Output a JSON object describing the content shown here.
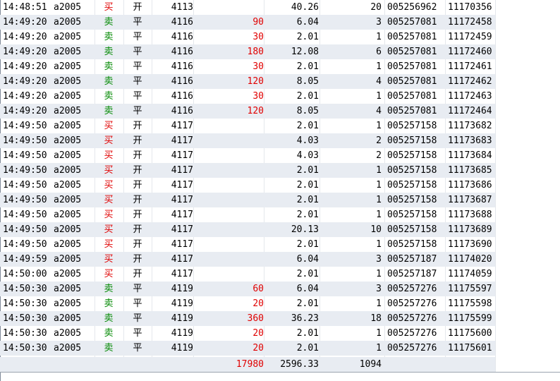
{
  "trades": [
    {
      "time": "14:48:51",
      "code": "a2005",
      "dir": "买",
      "oc": "开",
      "px": "4113",
      "diff": "",
      "price": "40.26",
      "qty": "20",
      "acct": "005256962",
      "order": "11170356"
    },
    {
      "time": "14:49:20",
      "code": "a2005",
      "dir": "卖",
      "oc": "平",
      "px": "4116",
      "diff": "90",
      "price": "6.04",
      "qty": "3",
      "acct": "005257081",
      "order": "11172458"
    },
    {
      "time": "14:49:20",
      "code": "a2005",
      "dir": "卖",
      "oc": "平",
      "px": "4116",
      "diff": "30",
      "price": "2.01",
      "qty": "1",
      "acct": "005257081",
      "order": "11172459"
    },
    {
      "time": "14:49:20",
      "code": "a2005",
      "dir": "卖",
      "oc": "平",
      "px": "4116",
      "diff": "180",
      "price": "12.08",
      "qty": "6",
      "acct": "005257081",
      "order": "11172460"
    },
    {
      "time": "14:49:20",
      "code": "a2005",
      "dir": "卖",
      "oc": "平",
      "px": "4116",
      "diff": "30",
      "price": "2.01",
      "qty": "1",
      "acct": "005257081",
      "order": "11172461"
    },
    {
      "time": "14:49:20",
      "code": "a2005",
      "dir": "卖",
      "oc": "平",
      "px": "4116",
      "diff": "120",
      "price": "8.05",
      "qty": "4",
      "acct": "005257081",
      "order": "11172462"
    },
    {
      "time": "14:49:20",
      "code": "a2005",
      "dir": "卖",
      "oc": "平",
      "px": "4116",
      "diff": "30",
      "price": "2.01",
      "qty": "1",
      "acct": "005257081",
      "order": "11172463"
    },
    {
      "time": "14:49:20",
      "code": "a2005",
      "dir": "卖",
      "oc": "平",
      "px": "4116",
      "diff": "120",
      "price": "8.05",
      "qty": "4",
      "acct": "005257081",
      "order": "11172464"
    },
    {
      "time": "14:49:50",
      "code": "a2005",
      "dir": "买",
      "oc": "开",
      "px": "4117",
      "diff": "",
      "price": "2.01",
      "qty": "1",
      "acct": "005257158",
      "order": "11173682"
    },
    {
      "time": "14:49:50",
      "code": "a2005",
      "dir": "买",
      "oc": "开",
      "px": "4117",
      "diff": "",
      "price": "4.03",
      "qty": "2",
      "acct": "005257158",
      "order": "11173683"
    },
    {
      "time": "14:49:50",
      "code": "a2005",
      "dir": "买",
      "oc": "开",
      "px": "4117",
      "diff": "",
      "price": "4.03",
      "qty": "2",
      "acct": "005257158",
      "order": "11173684"
    },
    {
      "time": "14:49:50",
      "code": "a2005",
      "dir": "买",
      "oc": "开",
      "px": "4117",
      "diff": "",
      "price": "2.01",
      "qty": "1",
      "acct": "005257158",
      "order": "11173685"
    },
    {
      "time": "14:49:50",
      "code": "a2005",
      "dir": "买",
      "oc": "开",
      "px": "4117",
      "diff": "",
      "price": "2.01",
      "qty": "1",
      "acct": "005257158",
      "order": "11173686"
    },
    {
      "time": "14:49:50",
      "code": "a2005",
      "dir": "买",
      "oc": "开",
      "px": "4117",
      "diff": "",
      "price": "2.01",
      "qty": "1",
      "acct": "005257158",
      "order": "11173687"
    },
    {
      "time": "14:49:50",
      "code": "a2005",
      "dir": "买",
      "oc": "开",
      "px": "4117",
      "diff": "",
      "price": "2.01",
      "qty": "1",
      "acct": "005257158",
      "order": "11173688"
    },
    {
      "time": "14:49:50",
      "code": "a2005",
      "dir": "买",
      "oc": "开",
      "px": "4117",
      "diff": "",
      "price": "20.13",
      "qty": "10",
      "acct": "005257158",
      "order": "11173689"
    },
    {
      "time": "14:49:50",
      "code": "a2005",
      "dir": "买",
      "oc": "开",
      "px": "4117",
      "diff": "",
      "price": "2.01",
      "qty": "1",
      "acct": "005257158",
      "order": "11173690"
    },
    {
      "time": "14:49:59",
      "code": "a2005",
      "dir": "买",
      "oc": "开",
      "px": "4117",
      "diff": "",
      "price": "6.04",
      "qty": "3",
      "acct": "005257187",
      "order": "11174020"
    },
    {
      "time": "14:50:00",
      "code": "a2005",
      "dir": "买",
      "oc": "开",
      "px": "4117",
      "diff": "",
      "price": "2.01",
      "qty": "1",
      "acct": "005257187",
      "order": "11174059"
    },
    {
      "time": "14:50:30",
      "code": "a2005",
      "dir": "卖",
      "oc": "平",
      "px": "4119",
      "diff": "60",
      "price": "6.04",
      "qty": "3",
      "acct": "005257276",
      "order": "11175597"
    },
    {
      "time": "14:50:30",
      "code": "a2005",
      "dir": "卖",
      "oc": "平",
      "px": "4119",
      "diff": "20",
      "price": "2.01",
      "qty": "1",
      "acct": "005257276",
      "order": "11175598"
    },
    {
      "time": "14:50:30",
      "code": "a2005",
      "dir": "卖",
      "oc": "平",
      "px": "4119",
      "diff": "360",
      "price": "36.23",
      "qty": "18",
      "acct": "005257276",
      "order": "11175599"
    },
    {
      "time": "14:50:30",
      "code": "a2005",
      "dir": "卖",
      "oc": "平",
      "px": "4119",
      "diff": "20",
      "price": "2.01",
      "qty": "1",
      "acct": "005257276",
      "order": "11175600"
    },
    {
      "time": "14:50:30",
      "code": "a2005",
      "dir": "卖",
      "oc": "平",
      "px": "4119",
      "diff": "20",
      "price": "2.01",
      "qty": "1",
      "acct": "005257276",
      "order": "11175601"
    }
  ],
  "totals": {
    "diff": "17980",
    "price": "2596.33",
    "qty": "1094"
  },
  "colors": {
    "buy": "#e00000",
    "sell": "#008800",
    "profit": "#e00000",
    "row_alt": "#e8ecf2"
  }
}
